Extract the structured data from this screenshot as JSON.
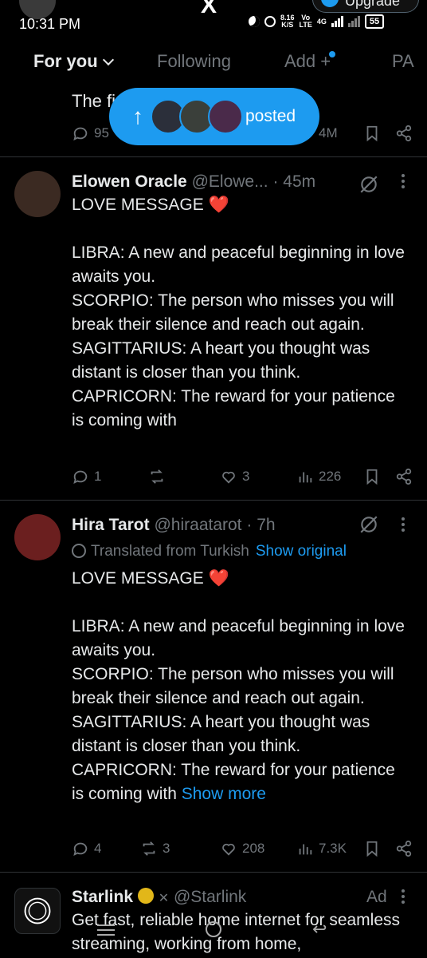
{
  "status": {
    "time": "10:31 PM",
    "speed_value": "8.16",
    "speed_unit": "K/S",
    "volte_top": "Vo",
    "volte_bottom": "LTE",
    "network": "4G",
    "battery": "55",
    "app_logo": "X",
    "upgrade_label": "Upgrade"
  },
  "tabs": [
    {
      "label": "For you"
    },
    {
      "label": "Following"
    },
    {
      "label": "Add +"
    },
    {
      "label": "PA"
    }
  ],
  "posted_pill": {
    "label": "posted"
  },
  "partial_post": {
    "text": "The fi",
    "replies": "95",
    "views": "4M"
  },
  "posts": [
    {
      "name": "Elowen Oracle",
      "handle": "@Elowe...",
      "time": "· 45m",
      "first_line": "LOVE MESSAGE ❤️",
      "body": "LIBRA: A new and peaceful beginning in love awaits you.\nSCORPIO: The person who misses you will break their silence and reach out again.\nSAGITTARIUS: A heart you thought was distant is closer than you think.\nCAPRICORN: The reward for your patience is coming with",
      "replies": "1",
      "reposts": "",
      "likes": "3",
      "views": "226"
    },
    {
      "name": "Hira Tarot",
      "handle": "@hiraatarot",
      "time": "· 7h",
      "translated": "Translated from Turkish",
      "show_original": "Show original",
      "first_line": "LOVE MESSAGE ❤️",
      "body": "LIBRA: A new and peaceful beginning in love awaits you.\nSCORPIO: The person who misses you will break their silence and reach out again.\nSAGITTARIUS: A heart you thought was distant is closer than you think.\nCAPRICORN: The reward for your patience is coming with",
      "show_more": "Show more",
      "replies": "4",
      "reposts": "3",
      "likes": "208",
      "views": "7.3K"
    },
    {
      "name": "Starlink",
      "handle": "@Starlink",
      "ad_label": "Ad",
      "body": "Get fast, reliable home internet for seamless streaming, working from home,"
    }
  ],
  "colors": {
    "background": "#000000",
    "accent": "#1d9bf0",
    "muted": "#71767b",
    "text": "#e7e9ea",
    "heart": "#f91880",
    "verified_gold": "#e2b719"
  },
  "icons": [
    "x-logo-icon",
    "upgrade-verified-icon",
    "arrow-up-icon",
    "reply-icon",
    "repost-icon",
    "like-icon",
    "views-icon",
    "bookmark-icon",
    "share-icon",
    "grok-icon",
    "more-icon",
    "translate-icon",
    "verified-gold-icon",
    "affiliate-x-icon",
    "menu-nav-icon",
    "home-nav-icon",
    "back-nav-icon"
  ]
}
